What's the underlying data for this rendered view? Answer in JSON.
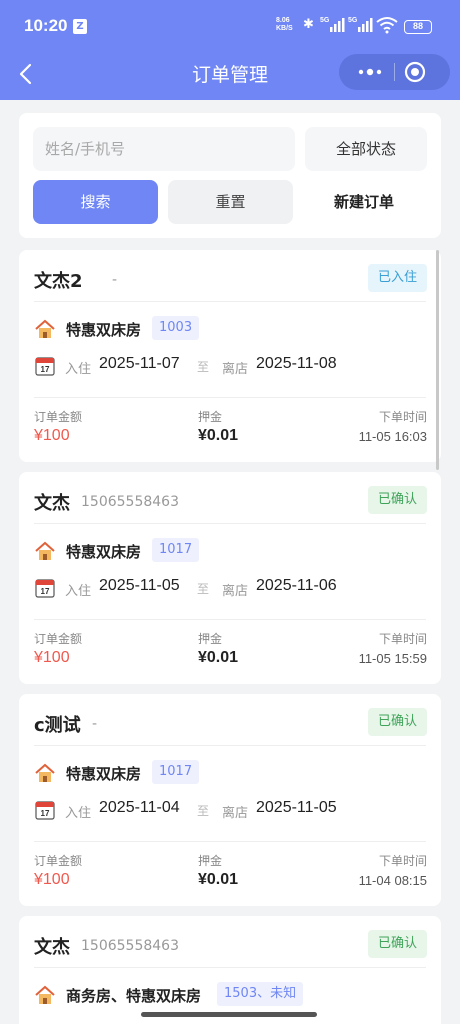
{
  "status_bar": {
    "time": "10:20",
    "app_badge": "Z",
    "net_speed_top": "8.06",
    "net_speed_bottom": "KB/S",
    "battery": "88"
  },
  "nav": {
    "title": "订单管理"
  },
  "search": {
    "placeholder": "姓名/手机号",
    "status_select": "全部状态",
    "search_button": "搜索",
    "reset_button": "重置",
    "new_order_button": "新建订单"
  },
  "labels": {
    "checkin": "入住",
    "to": "至",
    "checkout": "离店",
    "amount": "订单金额",
    "deposit": "押金",
    "order_time": "下单时间"
  },
  "orders": [
    {
      "name": "文杰2",
      "phone": "-",
      "status": "已入住",
      "room_type": "特惠双床房",
      "room_no": "1003",
      "checkin_date": "2025-11-07",
      "checkout_date": "2025-11-08",
      "amount": "¥100",
      "deposit": "¥0.01",
      "order_time": "11-05 16:03"
    },
    {
      "name": "文杰",
      "phone": "15065558463",
      "status": "已确认",
      "room_type": "特惠双床房",
      "room_no": "1017",
      "checkin_date": "2025-11-05",
      "checkout_date": "2025-11-06",
      "amount": "¥100",
      "deposit": "¥0.01",
      "order_time": "11-05 15:59"
    },
    {
      "name": "c测试",
      "phone": "-",
      "status": "已确认",
      "room_type": "特惠双床房",
      "room_no": "1017",
      "checkin_date": "2025-11-04",
      "checkout_date": "2025-11-05",
      "amount": "¥100",
      "deposit": "¥0.01",
      "order_time": "11-04 08:15"
    },
    {
      "name": "文杰",
      "phone": "15065558463",
      "status": "已确认",
      "room_type": "商务房、特惠双床房",
      "room_no": "1503、未知"
    }
  ],
  "icons": {
    "back": "back-arrow-icon",
    "more": "more-dots-icon",
    "close": "mini-program-close-icon",
    "house": "house-icon",
    "calendar": "calendar-icon"
  },
  "colors": {
    "primary": "#6f86f4",
    "amount_red": "#f0594e",
    "checkin_badge": "#3a9fd4",
    "confirmed_badge": "#3fa45a"
  }
}
